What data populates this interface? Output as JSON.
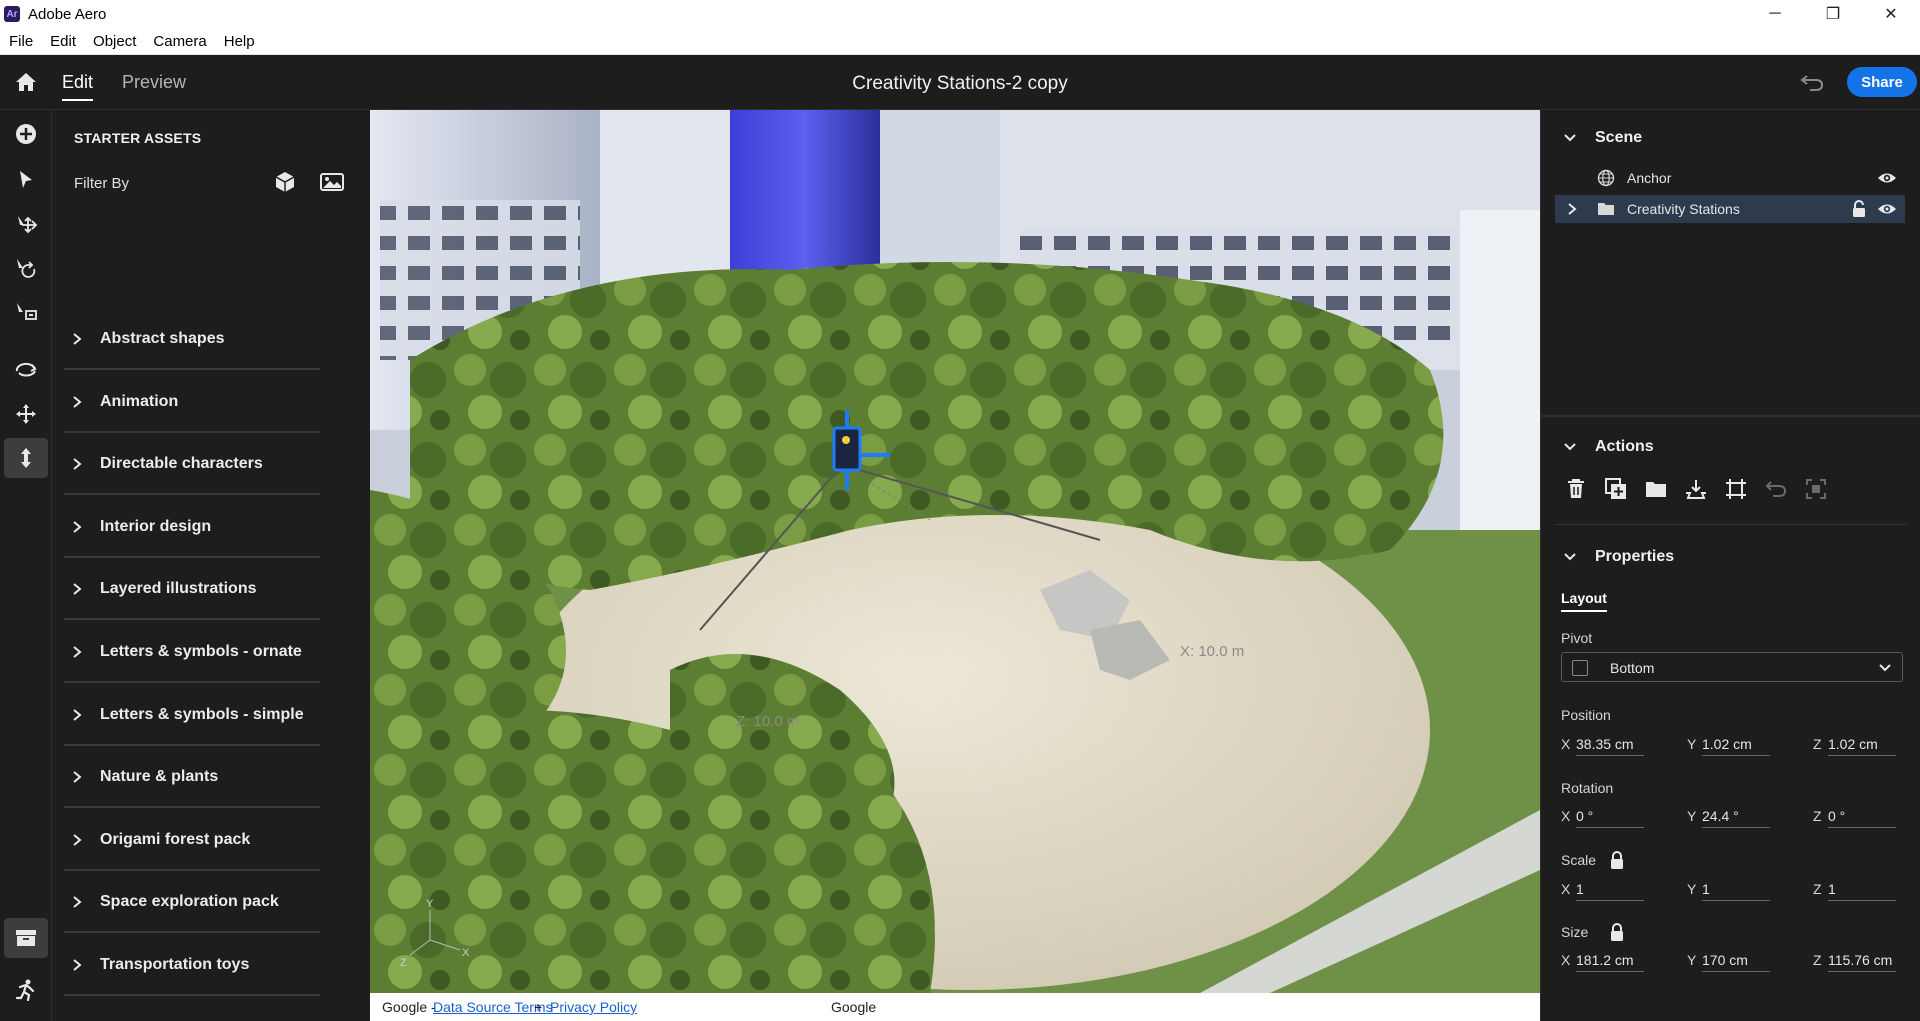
{
  "window": {
    "icon_text": "Ar",
    "title": "Adobe Aero",
    "minimize": "─",
    "maximize": "❐",
    "close": "✕"
  },
  "menu": [
    "File",
    "Edit",
    "Object",
    "Camera",
    "Help"
  ],
  "header": {
    "tabs": {
      "edit": "Edit",
      "preview": "Preview"
    },
    "document_title": "Creativity Stations-2 copy",
    "share_label": "Share"
  },
  "tools": [
    "add-icon",
    "select-icon",
    "move-icon",
    "rotate-icon",
    "scale-icon",
    "orbit-icon",
    "pan-icon",
    "dolly-icon",
    "assets-drawer-icon",
    "behaviors-icon"
  ],
  "assets": {
    "heading": "STARTER ASSETS",
    "filter_label": "Filter By",
    "categories": [
      "Abstract shapes",
      "Animation",
      "Directable characters",
      "Interior design",
      "Layered illustrations",
      "Letters & symbols - ornate",
      "Letters & symbols - simple",
      "Nature & plants",
      "Origami forest pack",
      "Space exploration pack",
      "Transportation toys"
    ]
  },
  "viewport": {
    "x_axis_label": "X: 10.0 m",
    "z_axis_label": "Z: 10.0 m",
    "gizmo_axes": {
      "y": "Y",
      "x": "X",
      "z": "Z"
    },
    "footer": {
      "google_prefix": "Google -",
      "data_terms": "Data Source Terms",
      "plus": "+",
      "privacy": "Privacy Policy",
      "google_center": "Google"
    }
  },
  "scene": {
    "title": "Scene",
    "items": [
      {
        "name": "Anchor",
        "icon": "globe-icon",
        "selected": false
      },
      {
        "name": "Creativity Stations",
        "icon": "folder-icon",
        "selected": true
      }
    ]
  },
  "actions": {
    "title": "Actions",
    "buttons": [
      "delete-icon",
      "duplicate-icon",
      "group-icon",
      "place-on-surface-icon",
      "fit-icon",
      "reset-icon",
      "ungroup-icon"
    ]
  },
  "properties": {
    "title": "Properties",
    "tab": "Layout",
    "pivot_label": "Pivot",
    "pivot_value": "Bottom",
    "position_label": "Position",
    "position": {
      "x": "38.35 cm",
      "y": "1.02 cm",
      "z": "1.02 cm"
    },
    "rotation_label": "Rotation",
    "rotation": {
      "x": "0 °",
      "y": "24.4 °",
      "z": "0 °"
    },
    "scale_label": "Scale",
    "scale": {
      "x": "1",
      "y": "1",
      "z": "1"
    },
    "size_label": "Size",
    "size": {
      "x": "181.2 cm",
      "y": "170 cm",
      "z": "115.76 cm"
    },
    "axis_letters": {
      "x": "X",
      "y": "Y",
      "z": "Z"
    }
  },
  "colors": {
    "accent": "#1473e6",
    "panel_bg": "#1d1d1d",
    "selection": "#2e3a4d",
    "gizmo": "#1e7bff"
  }
}
